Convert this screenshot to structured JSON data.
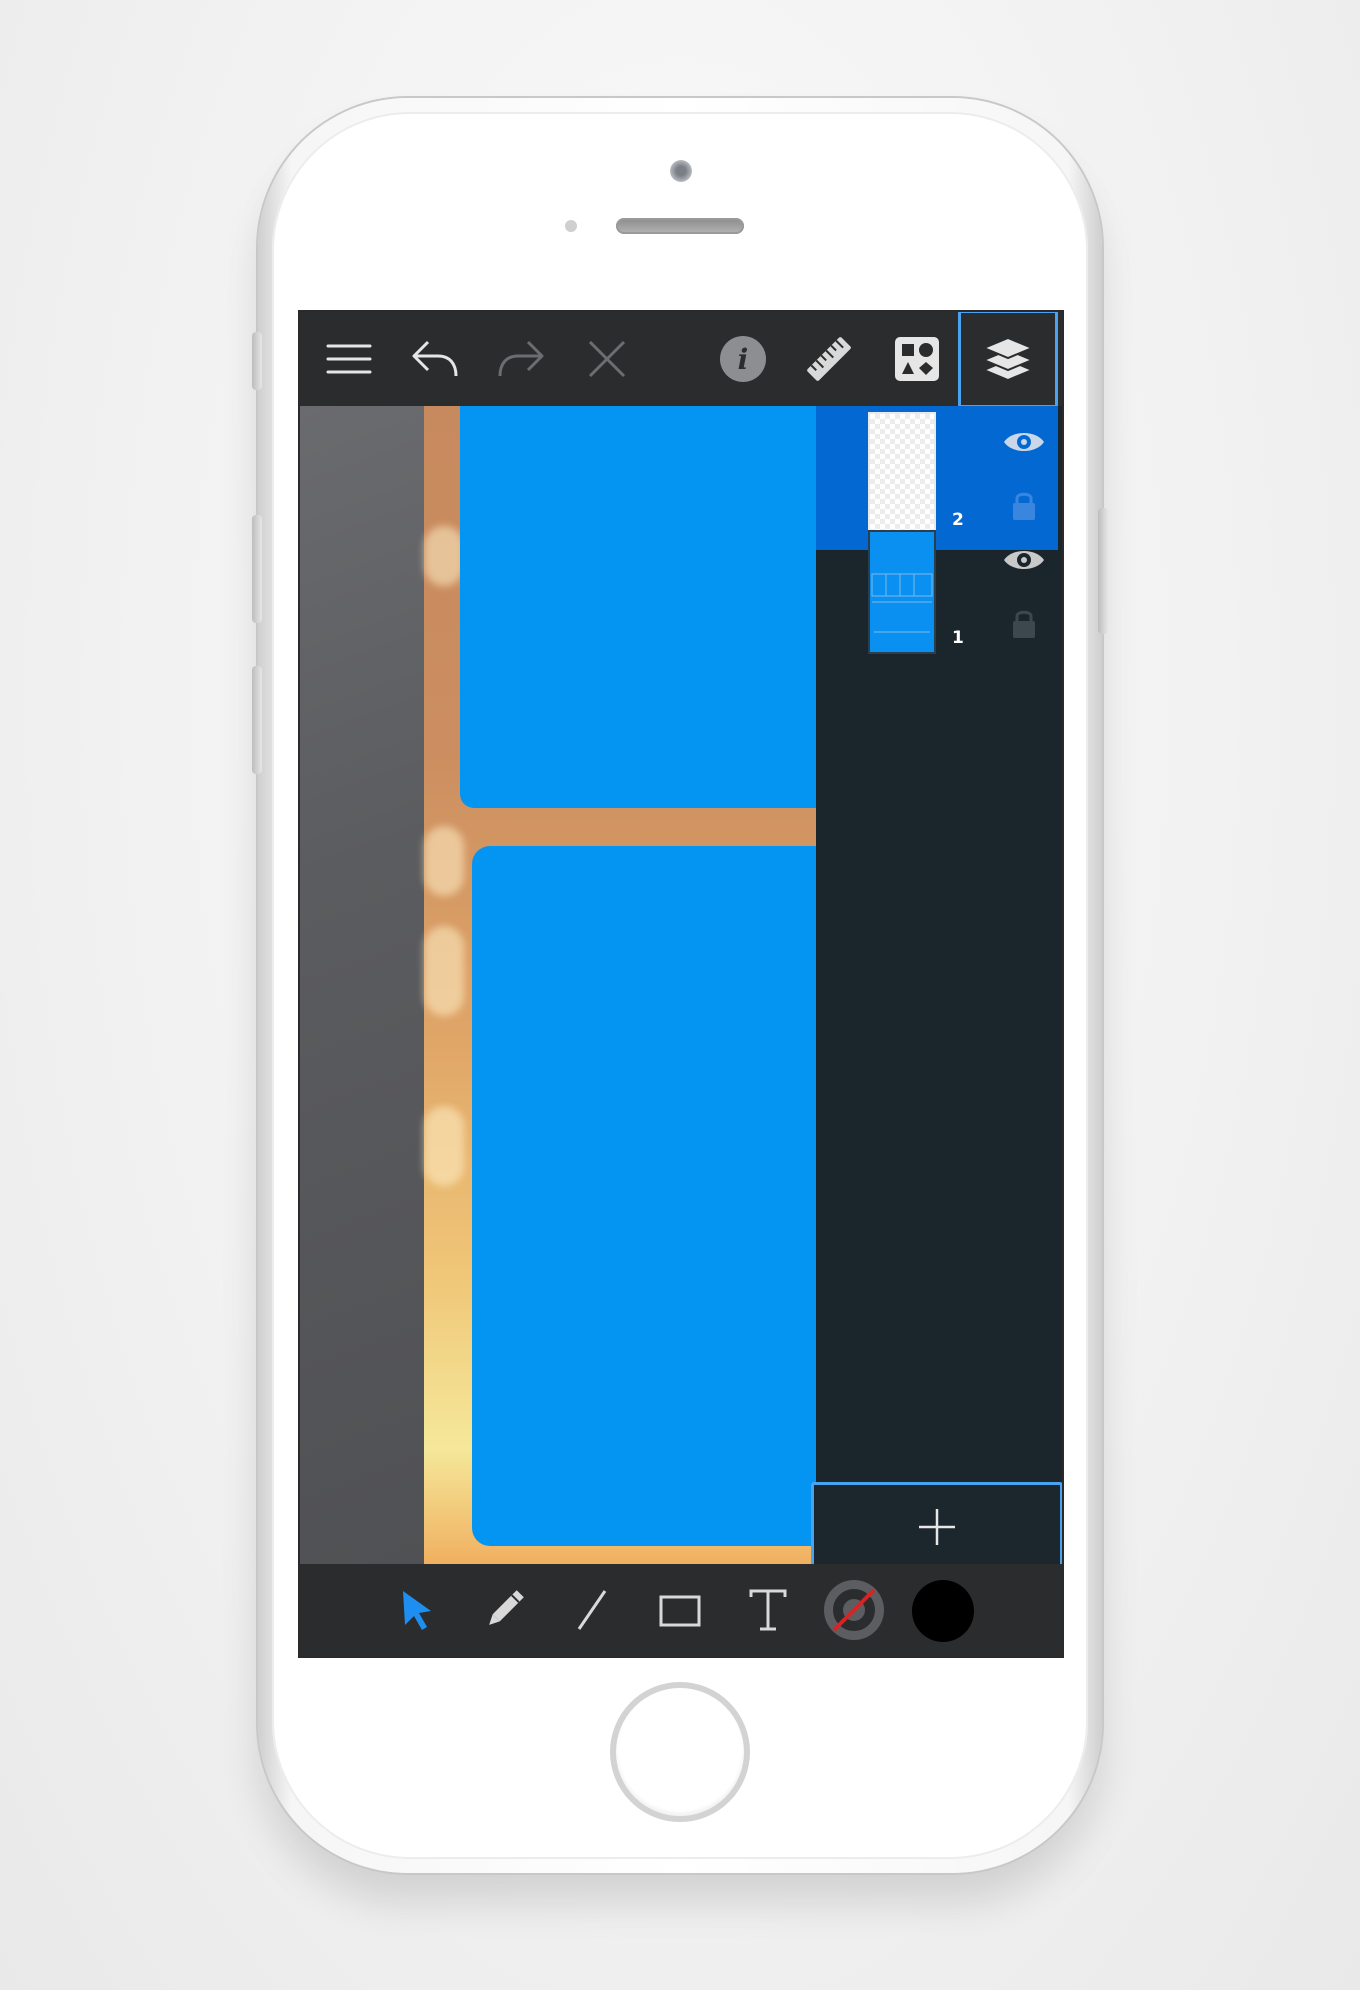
{
  "toolbar": {
    "icons": [
      "menu-icon",
      "undo-icon",
      "redo-icon",
      "close-icon",
      "info-icon",
      "ruler-icon",
      "shapes-library-icon",
      "layers-icon"
    ]
  },
  "layers": [
    {
      "number": "2",
      "selected": true,
      "thumbnail": "empty-transparent",
      "visible": true,
      "locked": false
    },
    {
      "number": "1",
      "selected": false,
      "thumbnail": "blue-panels",
      "visible": true,
      "locked": false
    }
  ],
  "add_layer": {
    "icon": "plus-icon"
  },
  "tools": [
    "select-arrow-icon",
    "pencil-icon",
    "line-icon",
    "rectangle-icon",
    "text-icon"
  ],
  "colors": {
    "accent": "#4aa3f0",
    "selected_layer": "#0468d2",
    "panel_blue": "#0395f1",
    "stroke_color": "none",
    "fill_color": "#000000",
    "active_tool": "#1e8ff0"
  }
}
